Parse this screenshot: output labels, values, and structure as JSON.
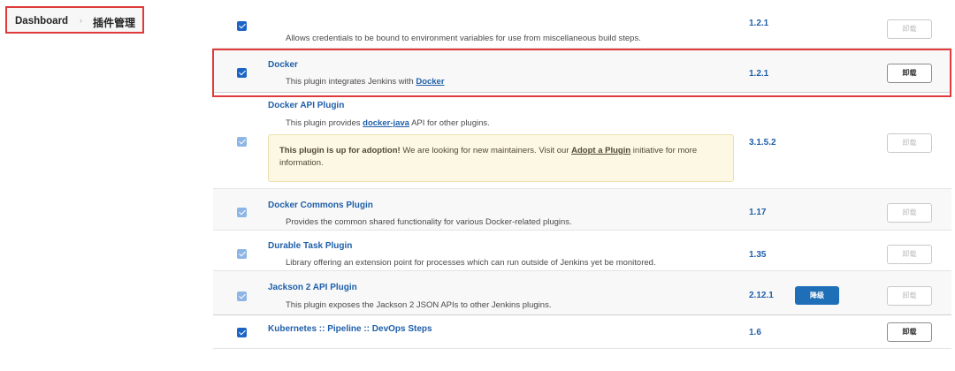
{
  "breadcrumb": {
    "dashboard": "Dashboard",
    "separator": "›",
    "current": "插件管理"
  },
  "plugins": [
    {
      "name": "",
      "description": "Allows credentials to be bound to environment variables for use from miscellaneous build steps.",
      "version": "1.2.1",
      "checked": true,
      "uninstall_label": "卸载"
    },
    {
      "name": "Docker",
      "description_prefix": "This plugin integrates Jenkins with ",
      "description_link": "Docker",
      "version": "1.2.1",
      "checked": true,
      "uninstall_label": "卸载"
    },
    {
      "name": "Docker API Plugin",
      "description_prefix": "This plugin provides ",
      "description_link": "docker-java",
      "description_suffix": " API for other plugins.",
      "version": "3.1.5.2",
      "checked": true,
      "uninstall_label": "卸载",
      "adoption": {
        "bold": "This plugin is up for adoption!",
        "text1": " We are looking for new maintainers. Visit our ",
        "link": "Adopt a Plugin",
        "text2": " initiative for more information."
      }
    },
    {
      "name": "Docker Commons Plugin",
      "description": "Provides the common shared functionality for various Docker-related plugins.",
      "version": "1.17",
      "checked": true,
      "uninstall_label": "卸载"
    },
    {
      "name": "Durable Task Plugin",
      "description": "Library offering an extension point for processes which can run outside of Jenkins yet be monitored.",
      "version": "1.35",
      "checked": true,
      "uninstall_label": "卸载"
    },
    {
      "name": "Jackson 2 API Plugin",
      "description": "This plugin exposes the Jackson 2 JSON APIs to other Jenkins plugins.",
      "version": "2.12.1",
      "checked": true,
      "uninstall_label": "卸载",
      "downgrade_label": "降级"
    },
    {
      "name": "Kubernetes :: Pipeline :: DevOps Steps",
      "description": "",
      "version": "1.6",
      "checked": true,
      "uninstall_label": "卸载"
    }
  ],
  "colors": {
    "accent": "#1f5fa9",
    "highlight_border": "#e03a3a",
    "adoption_bg": "#fdf8e3",
    "button_blue": "#1e6fb8"
  }
}
